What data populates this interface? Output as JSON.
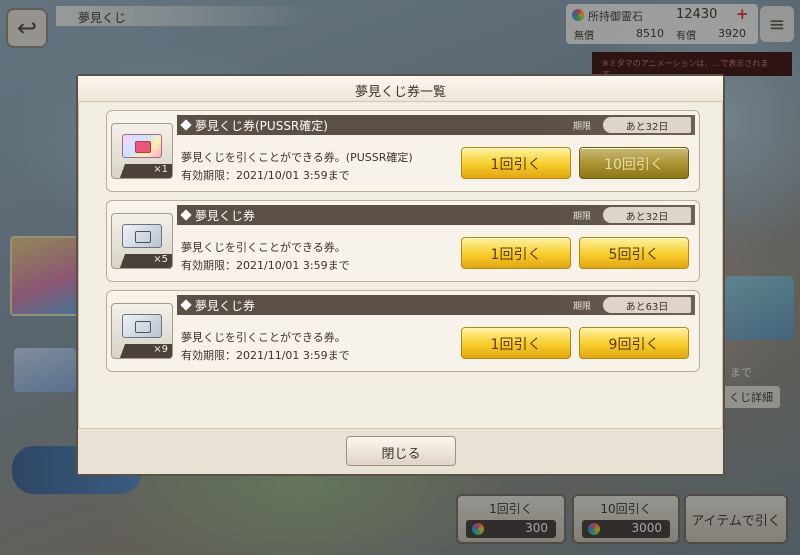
{
  "screen": {
    "title": "夢見くじ",
    "back_icon": "back-arrow-icon",
    "menu_icon": "hamburger-menu-icon"
  },
  "currency": {
    "label": "所持御霊石",
    "total": "12430",
    "free_label": "無償",
    "free_value": "8510",
    "paid_label": "有償",
    "paid_value": "3920",
    "plus_label": "+"
  },
  "notice": {
    "text": "※ミタマのアニメーションは、…で表示されます。"
  },
  "side": {
    "text": "まで",
    "detail_button": "くじ詳細"
  },
  "bottom_buttons": [
    {
      "label": "1回引く",
      "cost": "300"
    },
    {
      "label": "10回引く",
      "cost": "3000"
    },
    {
      "label": "アイテムで引く"
    }
  ],
  "modal": {
    "title": "夢見くじ券一覧",
    "close_label": "閉じる",
    "tickets": [
      {
        "name": "夢見くじ券(PUSSR確定)",
        "count": "×1",
        "period_label": "期限",
        "period_value": "あと32日",
        "description": "夢見くじを引くことができる券。(PUSSR確定)",
        "expiry": "有効期限：2021/10/01 3:59まで",
        "buttons": [
          "1回引く",
          "10回引く"
        ],
        "second_enabled": false
      },
      {
        "name": "夢見くじ券",
        "count": "×5",
        "period_label": "期限",
        "period_value": "あと32日",
        "description": "夢見くじを引くことができる券。",
        "expiry": "有効期限：2021/10/01 3:59まで",
        "buttons": [
          "1回引く",
          "5回引く"
        ],
        "second_enabled": true
      },
      {
        "name": "夢見くじ券",
        "count": "×9",
        "period_label": "期限",
        "period_value": "あと63日",
        "description": "夢見くじを引くことができる券。",
        "expiry": "有効期限：2021/11/01 3:59まで",
        "buttons": [
          "1回引く",
          "9回引く"
        ],
        "second_enabled": true
      }
    ]
  }
}
